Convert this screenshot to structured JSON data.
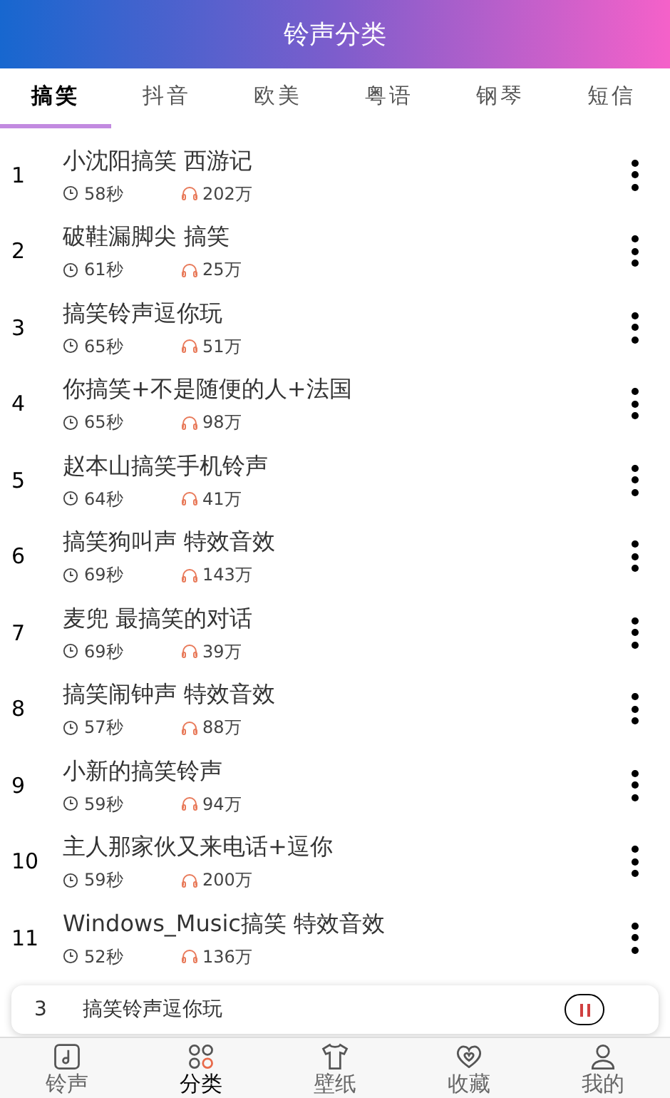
{
  "header": {
    "title": "铃声分类"
  },
  "tabs": [
    {
      "label": "搞笑",
      "selected": true
    },
    {
      "label": "抖音",
      "selected": false
    },
    {
      "label": "欧美",
      "selected": false
    },
    {
      "label": "粤语",
      "selected": false
    },
    {
      "label": "钢琴",
      "selected": false
    },
    {
      "label": "短信",
      "selected": false
    }
  ],
  "songs": [
    {
      "rank": "1",
      "title": "小沈阳搞笑 西游记",
      "duration": "58秒",
      "plays": "202万"
    },
    {
      "rank": "2",
      "title": "破鞋漏脚尖 搞笑",
      "duration": "61秒",
      "plays": "25万"
    },
    {
      "rank": "3",
      "title": "搞笑铃声逗你玩",
      "duration": "65秒",
      "plays": "51万"
    },
    {
      "rank": "4",
      "title": "你搞笑+不是随便的人+法国",
      "duration": "65秒",
      "plays": "98万"
    },
    {
      "rank": "5",
      "title": "赵本山搞笑手机铃声",
      "duration": "64秒",
      "plays": "41万"
    },
    {
      "rank": "6",
      "title": "搞笑狗叫声 特效音效",
      "duration": "69秒",
      "plays": "143万"
    },
    {
      "rank": "7",
      "title": "麦兜 最搞笑的对话",
      "duration": "69秒",
      "plays": "39万"
    },
    {
      "rank": "8",
      "title": "搞笑闹钟声 特效音效",
      "duration": "57秒",
      "plays": "88万"
    },
    {
      "rank": "9",
      "title": "小新的搞笑铃声",
      "duration": "59秒",
      "plays": "94万"
    },
    {
      "rank": "10",
      "title": "主人那家伙又来电话+逗你",
      "duration": "59秒",
      "plays": "200万"
    },
    {
      "rank": "11",
      "title": "Windows_Music搞笑 特效音效",
      "duration": "52秒",
      "plays": "136万"
    }
  ],
  "player": {
    "rank": "3",
    "title": "搞笑铃声逗你玩",
    "playing": true
  },
  "nav": [
    {
      "label": "铃声",
      "kind": "note",
      "selected": false
    },
    {
      "label": "分类",
      "kind": "grid",
      "selected": true
    },
    {
      "label": "壁纸",
      "kind": "shirt",
      "selected": false
    },
    {
      "label": "收藏",
      "kind": "heart",
      "selected": false
    },
    {
      "label": "我的",
      "kind": "person",
      "selected": false
    }
  ]
}
